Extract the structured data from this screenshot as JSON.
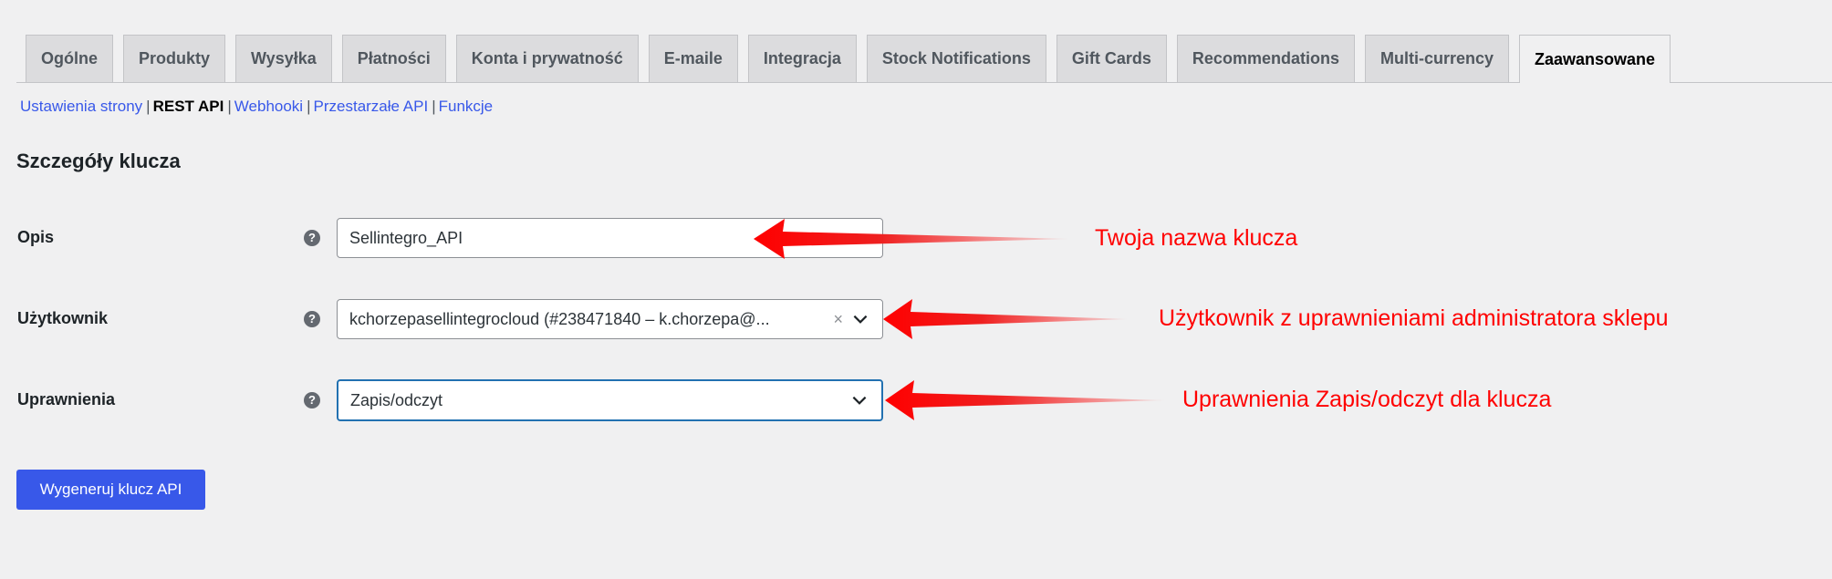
{
  "tabs": [
    {
      "label": "Ogólne"
    },
    {
      "label": "Produkty"
    },
    {
      "label": "Wysyłka"
    },
    {
      "label": "Płatności"
    },
    {
      "label": "Konta i prywatność"
    },
    {
      "label": "E-maile"
    },
    {
      "label": "Integracja"
    },
    {
      "label": "Stock Notifications"
    },
    {
      "label": "Gift Cards"
    },
    {
      "label": "Recommendations"
    },
    {
      "label": "Multi-currency"
    },
    {
      "label": "Zaawansowane",
      "active": true
    }
  ],
  "subnav": {
    "items": [
      "Ustawienia strony",
      "REST API",
      "Webhooki",
      "Przestarzałe API",
      "Funkcje"
    ],
    "separator": "|",
    "current": "REST API"
  },
  "section_title": "Szczegóły klucza",
  "form": {
    "description": {
      "label": "Opis",
      "value": "Sellintegro_API"
    },
    "user": {
      "label": "Użytkownik",
      "value": "kchorzepasellintegrocloud (#238471840 – k.chorzepa@...",
      "clear": "×"
    },
    "permissions": {
      "label": "Uprawnienia",
      "value": "Zapis/odczyt"
    },
    "help_glyph": "?",
    "submit_label": "Wygeneruj klucz API"
  },
  "annotations": [
    "Twoja nazwa klucza",
    "Użytkownik z uprawnieniami administratora sklepu",
    "Uprawnienia Zapis/odczyt dla klucza"
  ],
  "colors": {
    "accent": "#3858e9",
    "annotation": "#ff0000",
    "focus": "#2271b1"
  }
}
